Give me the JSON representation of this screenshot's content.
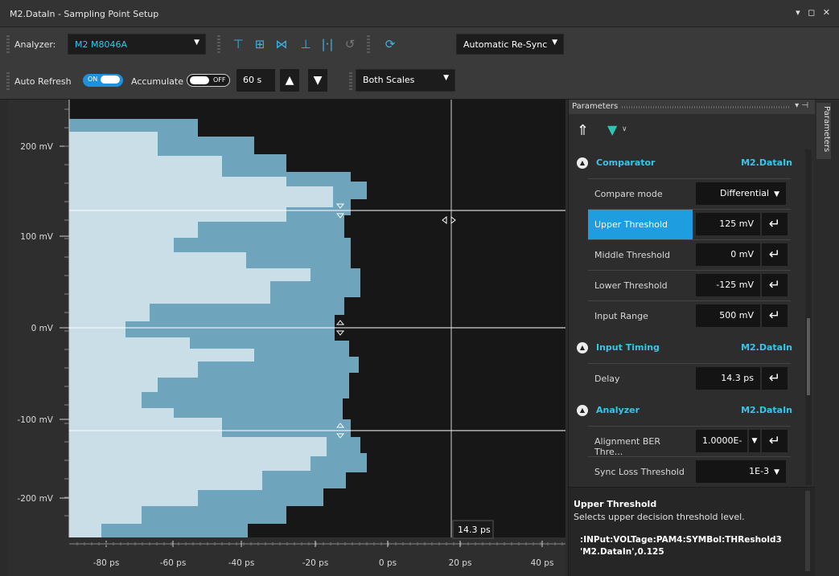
{
  "window": {
    "title": "M2.DataIn - Sampling Point Setup",
    "controls": "▾ ◻ ✕"
  },
  "toolbar": {
    "analyzer_label": "Analyzer:",
    "analyzer_value": "M2 M8046A",
    "resync_mode": "Automatic Re-Sync",
    "auto_refresh_label": "Auto Refresh",
    "auto_refresh_state": "ON",
    "accumulate_label": "Accumulate",
    "accumulate_state": "OFF",
    "interval": "60 s",
    "scale_mode": "Both Scales"
  },
  "plot": {
    "y_ticks": [
      "200 mV",
      "100 mV",
      "0 mV",
      "-100 mV",
      "-200 mV"
    ],
    "x_ticks": [
      "-80 ps",
      "-60 ps",
      "-40 ps",
      "-20 ps",
      "0 ps",
      "20 ps",
      "40 ps"
    ],
    "cursor_label": "14.3 ps",
    "colors": {
      "outer": "#6ea4bc",
      "inner": "#c9dee7",
      "background": "#171717"
    }
  },
  "parameters": {
    "panel_title": "Parameters",
    "side_tab_label": "Parameters",
    "sections": {
      "comparator": {
        "name": "Comparator",
        "device": "M2.DataIn"
      },
      "input_timing": {
        "name": "Input Timing",
        "device": "M2.DataIn"
      },
      "analyzer": {
        "name": "Analyzer",
        "device": "M2.DataIn"
      }
    },
    "rows": {
      "compare_mode": {
        "name": "Compare mode",
        "value": "Differential"
      },
      "upper_threshold": {
        "name": "Upper Threshold",
        "value": "125 mV"
      },
      "middle_threshold": {
        "name": "Middle Threshold",
        "value": "0 mV"
      },
      "lower_threshold": {
        "name": "Lower Threshold",
        "value": "-125 mV"
      },
      "input_range": {
        "name": "Input Range",
        "value": "500 mV"
      },
      "delay": {
        "name": "Delay",
        "value": "14.3 ps"
      },
      "alignment_ber": {
        "name": "Alignment BER Thre...",
        "value": "1.0000E-"
      },
      "sync_loss": {
        "name": "Sync Loss Threshold",
        "value": "1E-3"
      }
    }
  },
  "help": {
    "title": "Upper Threshold",
    "description": "Selects upper decision threshold level.",
    "command": ":INPut:VOLTage:PAM4:SYMBol:THReshold3 'M2.DataIn',0.125"
  }
}
